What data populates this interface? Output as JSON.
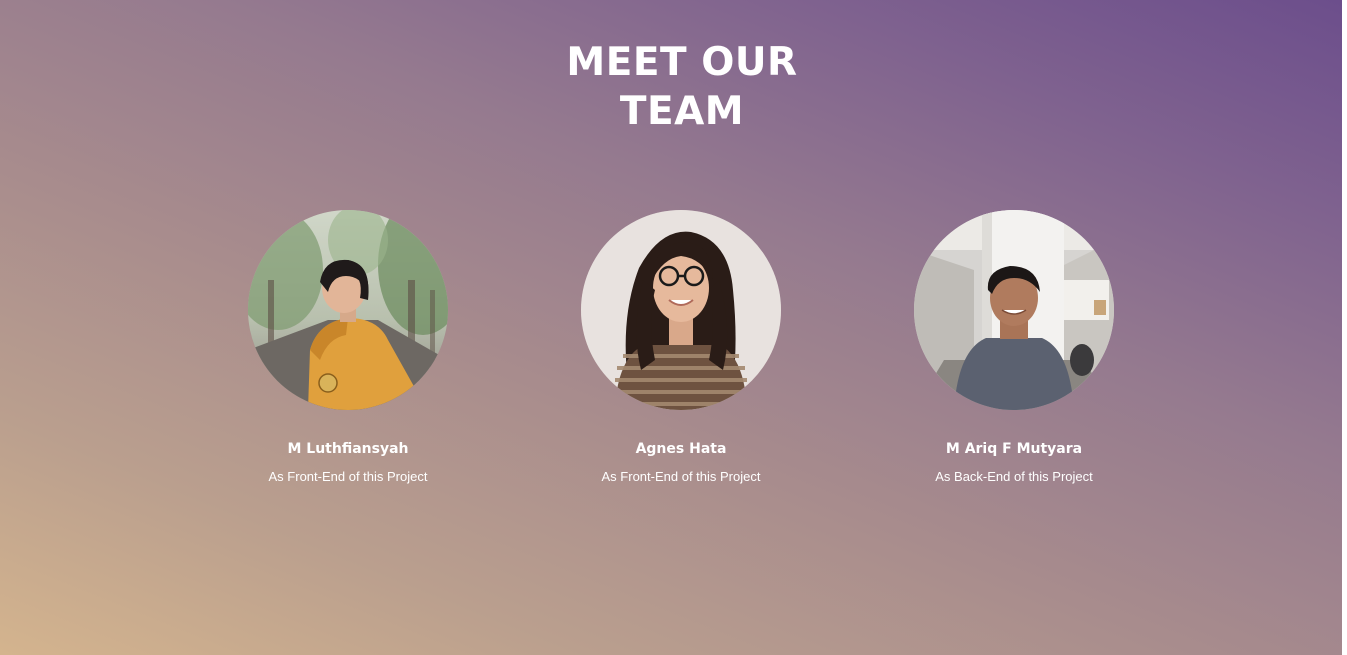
{
  "section": {
    "title_line1": "MEET OUR",
    "title_line2": "TEAM"
  },
  "team": [
    {
      "name": "M Luthfiansyah",
      "role": "As Front-End of this Project"
    },
    {
      "name": "Agnes Hata",
      "role": "As Front-End of this Project"
    },
    {
      "name": "M Ariq F Mutyara",
      "role": "As Back-End of this Project"
    }
  ]
}
